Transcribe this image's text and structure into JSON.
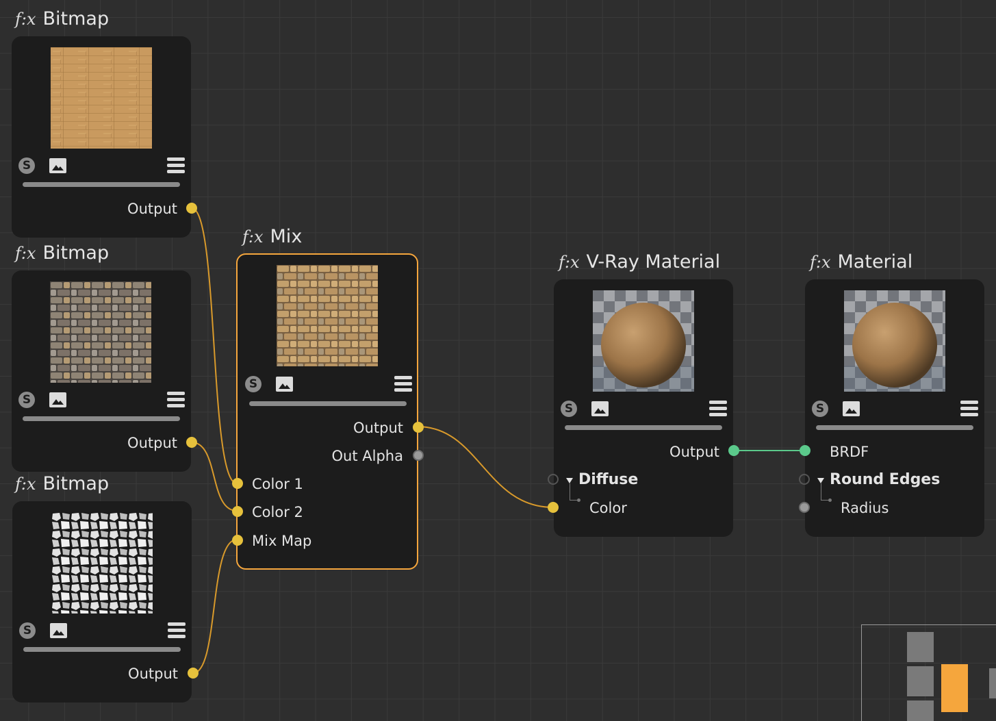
{
  "fx_glyph": "f:x",
  "colors": {
    "accent": "#f5a63d",
    "port_color": "#e6c13c",
    "port_bsdf": "#5bc98b",
    "wire_color": "#d99a2b",
    "wire_bsdf": "#5bc98b",
    "node_bg": "#1c1c1c",
    "canvas_bg": "#2e2e2e"
  },
  "nodes": {
    "bitmap1": {
      "title": "Bitmap",
      "output": "Output",
      "thumbnail": "wood-texture"
    },
    "bitmap2": {
      "title": "Bitmap",
      "output": "Output",
      "thumbnail": "stone-wall-texture"
    },
    "bitmap3": {
      "title": "Bitmap",
      "output": "Output",
      "thumbnail": "stone-mask-texture"
    },
    "mix": {
      "title": "Mix",
      "selected": true,
      "outputs": [
        "Output",
        "Out Alpha"
      ],
      "inputs": [
        "Color 1",
        "Color 2",
        "Mix Map"
      ],
      "thumbnail": "mixed-texture"
    },
    "vray": {
      "title": "V-Ray Material",
      "output": "Output",
      "group": "Diffuse",
      "input": "Color",
      "thumbnail": "material-sphere"
    },
    "material": {
      "title": "Material",
      "input_top": "BRDF",
      "group": "Round Edges",
      "input": "Radius",
      "thumbnail": "material-sphere"
    }
  },
  "icons": {
    "shader": "shader-icon",
    "preview": "image-icon",
    "menu": "menu-icon"
  }
}
